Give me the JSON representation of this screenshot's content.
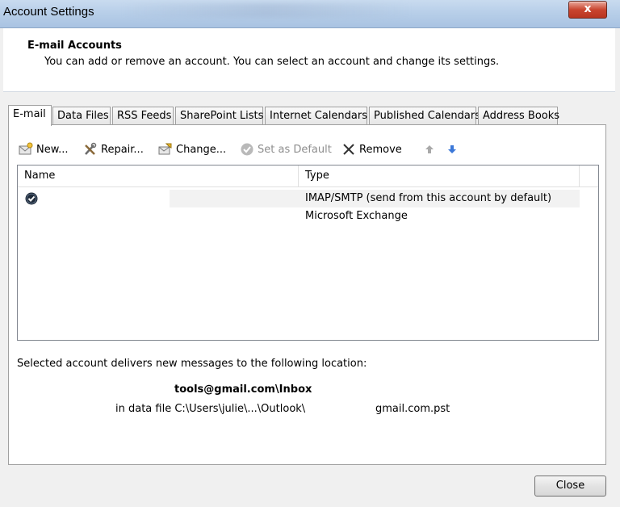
{
  "window": {
    "title": "Account Settings",
    "close_glyph": "x"
  },
  "header": {
    "title": "E-mail Accounts",
    "subtitle": "You can add or remove an account. You can select an account and change its settings."
  },
  "tabs": [
    {
      "label": "E-mail",
      "active": true
    },
    {
      "label": "Data Files"
    },
    {
      "label": "RSS Feeds"
    },
    {
      "label": "SharePoint Lists"
    },
    {
      "label": "Internet Calendars"
    },
    {
      "label": "Published Calendars"
    },
    {
      "label": "Address Books"
    }
  ],
  "toolbar": {
    "new": "New...",
    "repair": "Repair...",
    "change": "Change...",
    "set_default": "Set as Default",
    "remove": "Remove"
  },
  "accounts_list": {
    "columns": [
      "Name",
      "Type"
    ],
    "rows": [
      {
        "name": "",
        "type": "IMAP/SMTP (send from this account by default)",
        "default": true,
        "selected": true
      },
      {
        "name": "",
        "type": "Microsoft Exchange"
      }
    ]
  },
  "delivery": {
    "label": "Selected account delivers new messages to the following location:",
    "inbox": "tools@gmail.com\\Inbox",
    "file_prefix": "in data file C:\\Users\\julie\\...\\Outlook\\",
    "file_suffix": "gmail.com.pst"
  },
  "buttons": {
    "close": "Close"
  },
  "colors": {
    "titlebar": "#b8cfe9",
    "close_red": "#c9452f",
    "accent_blue": "#3b78d8"
  }
}
